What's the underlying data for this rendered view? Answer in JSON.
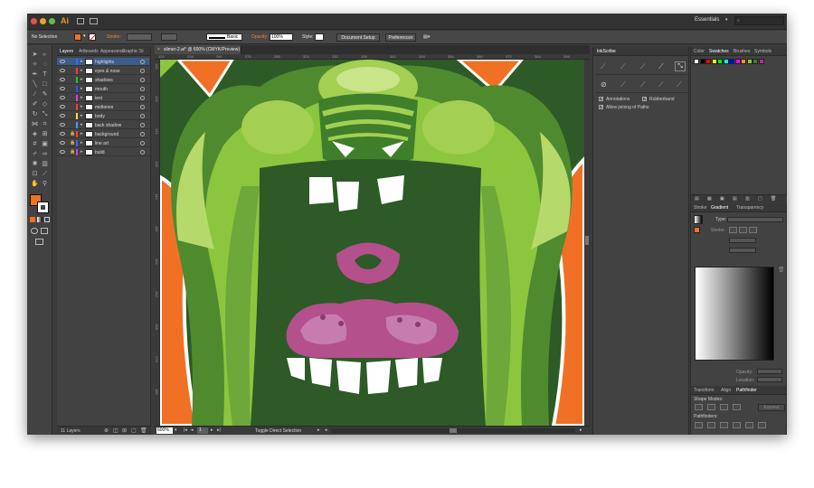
{
  "app": {
    "logo": "Ai",
    "workspace": "Essentials",
    "search_placeholder": ""
  },
  "control_bar": {
    "selection": "No Selection",
    "stroke_label": "Stroke:",
    "brush_label": "Basic",
    "opacity_label": "Opacity:",
    "opacity_value": "100%",
    "style_label": "Style:",
    "document_setup": "Document Setup",
    "preferences": "Preferences"
  },
  "document": {
    "tab_title": "slimer-2.ai* @ 600% (CMYK/Preview)",
    "ruler_ticks": [
      "120",
      "234",
      "240",
      "276",
      "288",
      "324",
      "330",
      "336",
      "342",
      "348",
      "354",
      "360",
      "372",
      "384",
      "396"
    ],
    "vertical_ticks": [
      "120",
      "126",
      "132",
      "138",
      "144",
      "150",
      "156",
      "162",
      "168",
      "174",
      "180"
    ]
  },
  "layers_panel": {
    "tabs": [
      "Layers",
      "Artboards",
      "Appearance",
      "Graphic St"
    ],
    "layers": [
      {
        "name": "highlights",
        "color": "#2f6bff",
        "selected": true
      },
      {
        "name": "eyes & nose",
        "color": "#ff3b3b",
        "selected": false
      },
      {
        "name": "shadows",
        "color": "#29c229",
        "selected": false
      },
      {
        "name": "mouth",
        "color": "#3a4dff",
        "selected": false
      },
      {
        "name": "text",
        "color": "#e43bdb",
        "selected": false
      },
      {
        "name": "midtones",
        "color": "#ff3b3b",
        "selected": false
      },
      {
        "name": "body",
        "color": "#f5e030",
        "selected": false
      },
      {
        "name": "back shadow",
        "color": "#3aa2ff",
        "selected": false
      },
      {
        "name": "background",
        "color": "#ff3b3b",
        "selected": false
      },
      {
        "name": "line art",
        "color": "#2f6bff",
        "selected": false
      },
      {
        "name": "build",
        "color": "#d93bd9",
        "selected": false
      }
    ],
    "footer": "11 Layers"
  },
  "inkscribe": {
    "title": "InkScribe",
    "annotations": "Annotations",
    "rubberband": "Rubberband",
    "allow_joining": "Allow joining of Paths"
  },
  "swatches": {
    "tabs": [
      "Color",
      "Swatches",
      "Brushes",
      "Symbols"
    ],
    "colors": [
      "#ffffff",
      "#000000",
      "#ff0000",
      "#ffff00",
      "#00ff00",
      "#00ffff",
      "#0000ff",
      "#ff00ff",
      "#f7931e",
      "#8cc63f",
      "#3f7e2a",
      "#c4278b"
    ]
  },
  "gradient": {
    "tabs": [
      "Stroke",
      "Gradient",
      "Transparency"
    ],
    "type_label": "Type:",
    "stroke_label": "Stroke:",
    "opacity_label": "Opacity:",
    "location_label": "Location:"
  },
  "pathfinder": {
    "tabs": [
      "Transform",
      "Align",
      "Pathfinder"
    ],
    "shape_modes": "Shape Modes:",
    "pathfinders": "Pathfinders:",
    "expand": "Expand"
  },
  "status_bar": {
    "zoom": "600%",
    "artboard": "1",
    "tool": "Toggle Direct Selection"
  },
  "colors": {
    "fill": "#f07126",
    "accent": "#3f7bd6",
    "dark_green": "#2d5a27",
    "light_green": "#8cc63f",
    "orange": "#f07126",
    "magenta": "#b4508c"
  }
}
